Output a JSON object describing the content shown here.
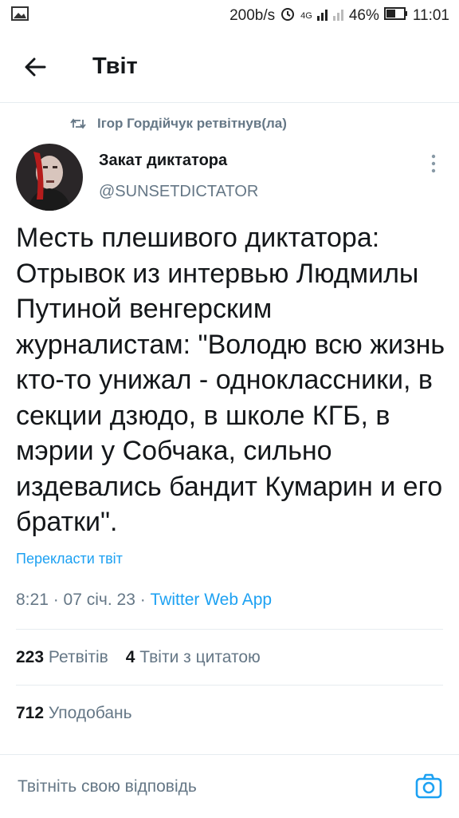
{
  "status_bar": {
    "speed": "200b/s",
    "network": "4G",
    "battery": "46%",
    "time": "11:01"
  },
  "header": {
    "title": "Твіт",
    "back_icon": "arrow-left-icon"
  },
  "tweet": {
    "retweeted_by": "Ігор Гордійчук ретвітнув(ла)",
    "author_name": "Закат диктатора",
    "author_handle": "@SUNSETDICTATOR",
    "text": "Месть плешивого диктатора: Отрывок из интервью Людмилы Путиной венгерским журналистам: \"Володю всю жизнь кто-то унижал - одноклассники, в секции дзюдо, в школе КГБ, в мэрии у Собчака, сильно издевались бандит Кумарин и его братки\".",
    "translate_label": "Перекласти твіт",
    "time": "8:21",
    "date": "07 січ. 23",
    "source": "Twitter Web App"
  },
  "stats": {
    "retweets_count": "223",
    "retweets_label": "Ретвітів",
    "quotes_count": "4",
    "quotes_label": "Твіти з цитатою",
    "likes_count": "712",
    "likes_label": "Уподобань"
  },
  "reply": {
    "placeholder": "Твітніть свою відповідь"
  },
  "colors": {
    "accent": "#1da1f2",
    "secondary_text": "#657786",
    "primary_text": "#14171a",
    "divider": "#e6ecf0"
  }
}
